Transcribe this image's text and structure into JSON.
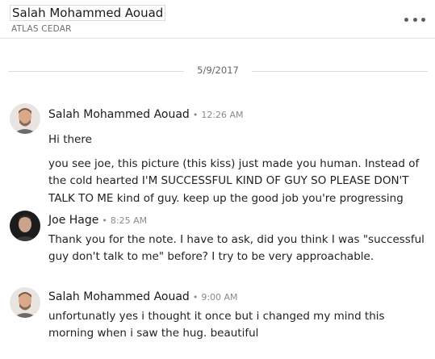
{
  "header": {
    "name": "Salah Mohammed Aouad",
    "subtitle": "ATLAS CEDAR",
    "more_icon": "more-horizontal-icon"
  },
  "date_divider": "5/9/2017",
  "messages": [
    {
      "sender": "Salah Mohammed Aouad",
      "separator": "•",
      "time": "12:26 AM",
      "avatar_icon": "avatar-salah",
      "lines": [
        "Hi there"
      ]
    },
    {
      "sender": "",
      "lines": [
        "you see joe, this picture (this kiss) just made you human. Instead of",
        "the cold hearted I'M SUCCESSFUL KIND OF GUY SO PLEASE DON'T",
        "TALK TO ME kind of guy. keep up the good job you're progressing"
      ]
    },
    {
      "sender": "Joe Hage",
      "separator": "•",
      "time": "8:25 AM",
      "avatar_icon": "avatar-joe",
      "lines": [
        "Thank you for the note. I have to ask, did you think I was \"successful",
        "guy don't talk to me\" before? I try to be very approachable."
      ]
    },
    {
      "sender": "Salah Mohammed Aouad",
      "separator": "•",
      "time": "9:00 AM",
      "avatar_icon": "avatar-salah",
      "lines": [
        "unfortunatly yes i thought it once but i changed my mind this",
        "morning when i saw the hug. beautiful"
      ]
    }
  ]
}
